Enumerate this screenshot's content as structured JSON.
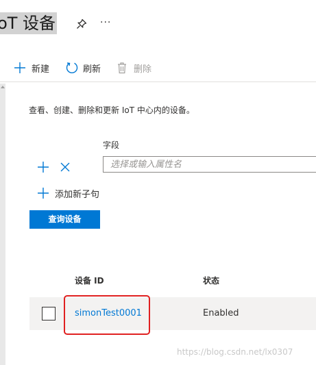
{
  "header": {
    "title": "IoT 设备",
    "pin_icon": "pin-icon",
    "more_label": "···"
  },
  "toolbar": {
    "new_label": "新建",
    "refresh_label": "刷新",
    "delete_label": "删除",
    "icons": [
      "plus-icon",
      "refresh-icon",
      "trash-icon"
    ]
  },
  "main": {
    "description": "查看、创建、删除和更新 IoT 中心内的设备。",
    "field": {
      "label": "字段",
      "placeholder": "选择或输入属性名",
      "value": ""
    },
    "add_clause_label": "添加新子句",
    "query_button_label": "查询设备"
  },
  "table": {
    "columns": [
      "设备 ID",
      "状态"
    ],
    "rows": [
      {
        "device_id": "simonTest0001",
        "status": "Enabled",
        "selected": false
      }
    ]
  },
  "watermark": "https://blog.csdn.net/lx0307",
  "colors": {
    "accent": "#0078d4",
    "annotation": "#e02020",
    "row_background": "#f3f2f1",
    "disabled_text": "#a19f9d"
  }
}
